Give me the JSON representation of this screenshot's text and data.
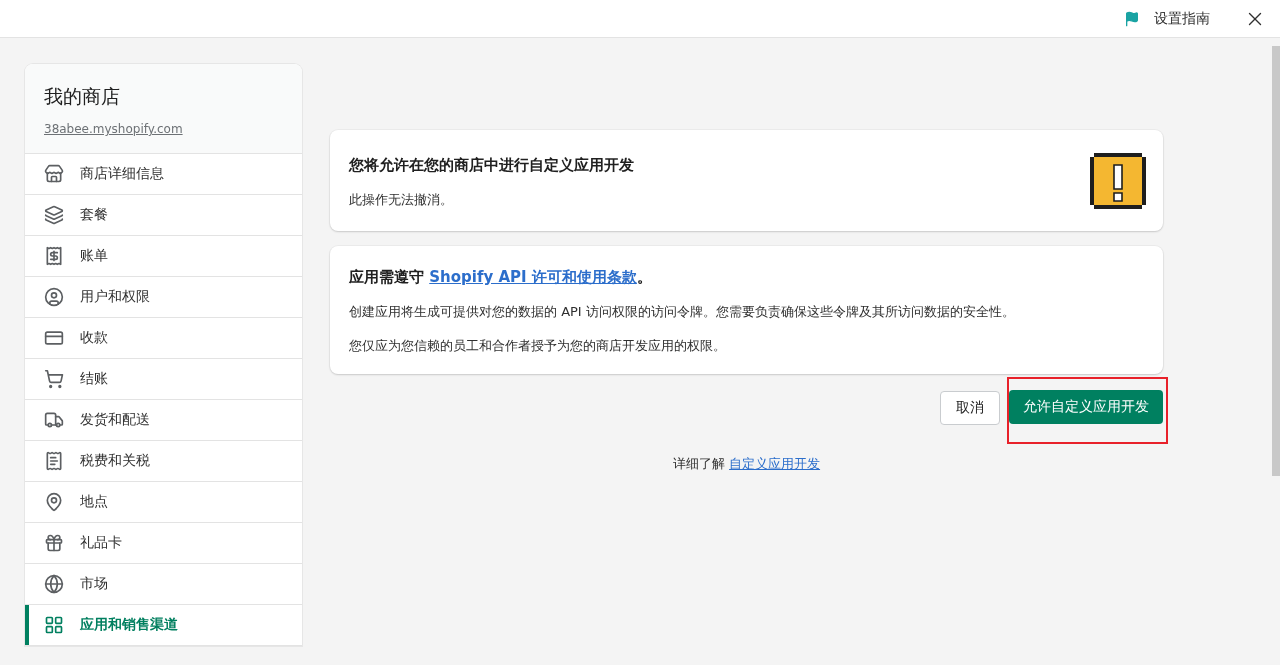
{
  "top_bar": {
    "guide": "设置指南"
  },
  "sidebar": {
    "store_name": "我的商店",
    "store_domain": "38abee.myshopify.com",
    "items": [
      {
        "label": "商店详细信息",
        "selected": false
      },
      {
        "label": "套餐",
        "selected": false
      },
      {
        "label": "账单",
        "selected": false
      },
      {
        "label": "用户和权限",
        "selected": false
      },
      {
        "label": "收款",
        "selected": false
      },
      {
        "label": "结账",
        "selected": false
      },
      {
        "label": "发货和配送",
        "selected": false
      },
      {
        "label": "税费和关税",
        "selected": false
      },
      {
        "label": "地点",
        "selected": false
      },
      {
        "label": "礼品卡",
        "selected": false
      },
      {
        "label": "市场",
        "selected": false
      },
      {
        "label": "应用和销售渠道",
        "selected": true
      }
    ]
  },
  "warning_card": {
    "title": "您将允许在您的商店中进行自定义应用开发",
    "text": "此操作无法撤消。"
  },
  "terms_card": {
    "title": "应用需遵守",
    "link": "Shopify API 许可和使用条款",
    "title_end": "。",
    "paragraphs": [
      "创建应用将生成可提供对您的数据的 API 访问权限的访问令牌。您需要负责确保这些令牌及其所访问数据的安全性。",
      "您仅应为您信赖的员工和合作者授予为您的商店开发应用的权限。"
    ]
  },
  "actions": {
    "cancel": "取消",
    "confirm": "允许自定义应用开发"
  },
  "learn_more": {
    "text": "详细了解",
    "link": "自定义应用开发"
  }
}
